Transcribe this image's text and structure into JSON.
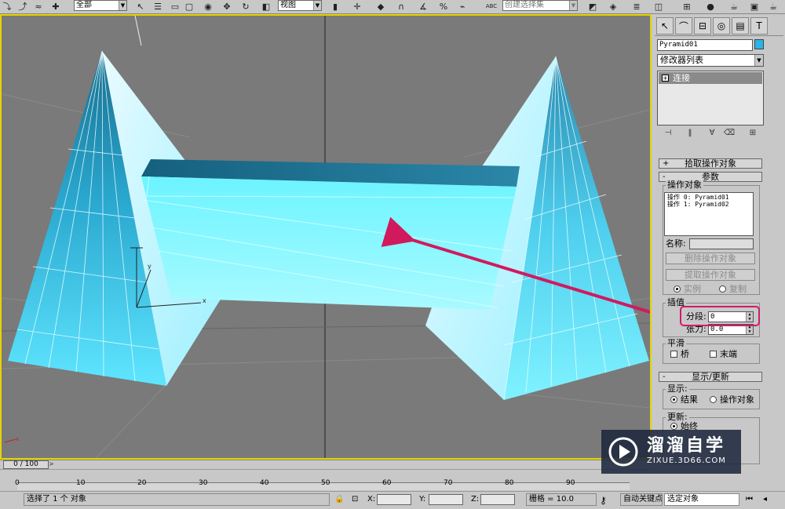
{
  "toolbar": {
    "selection_filter": "全部",
    "ref_coord": "视图",
    "named_selection": "创建选择集",
    "abc_label": "ABC"
  },
  "viewport": {
    "axis_x": "x",
    "axis_y": "y",
    "corner_x": "x",
    "annotation_arrow_color": "#d11a5e",
    "border_color": "#e6d200",
    "background": "#7a7a7a"
  },
  "command_panel": {
    "object_name": "Pyramid01",
    "object_color": "#2ab4e8",
    "modifier_list": "修改器列表",
    "stack_item": "连接",
    "rollouts": {
      "pick": "拾取操作对象",
      "params": "参数",
      "display": "显示/更新"
    },
    "operands_group": "操作对象",
    "operands": [
      "操作 0: Pyramid01",
      "操作 1: Pyramid02"
    ],
    "name_label": "名称:",
    "delete_operand": "删除操作对象",
    "extract_operand": "提取操作对象",
    "instance": "实例",
    "copy": "复制",
    "interp_group": "插值",
    "segments_label": "分段:",
    "segments_value": "0",
    "tension_label": "张力:",
    "tension_value": "0.0",
    "smooth_group": "平滑",
    "bridge": "桥",
    "ends": "末端",
    "display_group": "显示:",
    "result": "结果",
    "operand_obj": "操作对象",
    "update_group": "更新:",
    "always": "始终"
  },
  "timeline": {
    "frame_display": "0 / 100",
    "ticks": [
      "0",
      "10",
      "20",
      "30",
      "40",
      "50",
      "60",
      "70",
      "80",
      "90"
    ],
    "time_position": 0
  },
  "status": {
    "selection": "选择了 1 个 对象",
    "x_label": "X:",
    "y_label": "Y:",
    "z_label": "Z:",
    "grid": "栅格 = 10.0",
    "auto_key": "自动关键点",
    "selected": "选定对象"
  },
  "watermark": {
    "brand": "溜溜自学",
    "url": "ZIXUE.3D66.COM"
  }
}
